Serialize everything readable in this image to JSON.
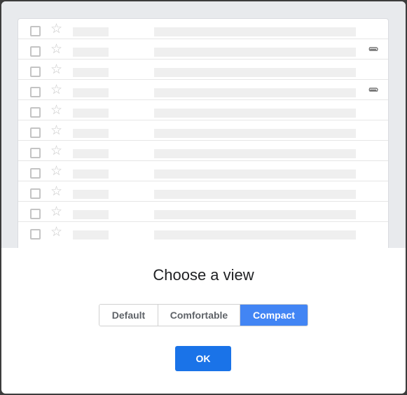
{
  "dialog": {
    "title": "Choose a view",
    "ok_label": "OK",
    "view_options": [
      {
        "label": "Default",
        "selected": false
      },
      {
        "label": "Comfortable",
        "selected": false
      },
      {
        "label": "Compact",
        "selected": true
      }
    ]
  },
  "preview": {
    "rows": [
      {
        "has_attachment": false
      },
      {
        "has_attachment": true
      },
      {
        "has_attachment": false
      },
      {
        "has_attachment": true
      },
      {
        "has_attachment": false
      },
      {
        "has_attachment": false
      },
      {
        "has_attachment": false
      },
      {
        "has_attachment": false
      },
      {
        "has_attachment": false
      },
      {
        "has_attachment": false
      },
      {
        "has_attachment": false
      }
    ],
    "star_glyph": "☆",
    "icons": {
      "checkbox": "checkbox-icon",
      "star": "star-icon",
      "attachment": "paperclip-icon"
    }
  },
  "colors": {
    "accent": "#1a73e8",
    "selected_segment": "#4285f4",
    "preview_background": "#e8eaed",
    "skeleton": "#efefef"
  }
}
